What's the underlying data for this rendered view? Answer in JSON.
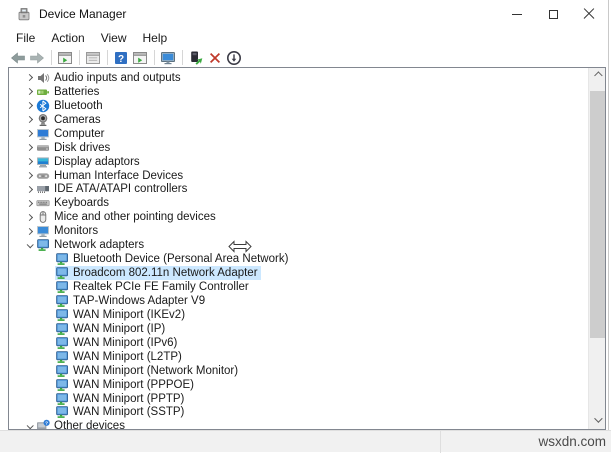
{
  "title_bar": {
    "title": "Device Manager",
    "controls": [
      {
        "name": "minimize-button"
      },
      {
        "name": "maximize-button"
      },
      {
        "name": "close-button"
      }
    ]
  },
  "menu_bar": {
    "items": [
      "File",
      "Action",
      "View",
      "Help"
    ]
  },
  "toolbar": {
    "items": [
      {
        "name": "back-button",
        "icon": "back-arrow-icon"
      },
      {
        "name": "forward-button",
        "icon": "forward-arrow-icon"
      },
      {
        "name": "separator"
      },
      {
        "name": "show-console-tree-button",
        "icon": "console-tree-icon"
      },
      {
        "name": "separator"
      },
      {
        "name": "export-list-button",
        "icon": "export-list-icon"
      },
      {
        "name": "separator"
      },
      {
        "name": "help-button",
        "icon": "help-icon"
      },
      {
        "name": "show-action-pane-button",
        "icon": "action-pane-icon"
      },
      {
        "name": "separator"
      },
      {
        "name": "properties-button",
        "icon": "computer-properties-icon"
      },
      {
        "name": "separator"
      },
      {
        "name": "update-driver-button",
        "icon": "update-driver-icon"
      },
      {
        "name": "uninstall-device-button",
        "icon": "uninstall-icon"
      },
      {
        "name": "scan-hardware-changes-button",
        "icon": "scan-changes-icon"
      }
    ]
  },
  "tree": {
    "items": [
      {
        "label": "Audio inputs and outputs",
        "icon": "audio-icon",
        "state": "collapsed",
        "level": 0
      },
      {
        "label": "Batteries",
        "icon": "battery-icon",
        "state": "collapsed",
        "level": 0
      },
      {
        "label": "Bluetooth",
        "icon": "bluetooth-icon",
        "state": "collapsed",
        "level": 0
      },
      {
        "label": "Cameras",
        "icon": "camera-icon",
        "state": "collapsed",
        "level": 0
      },
      {
        "label": "Computer",
        "icon": "computer-icon",
        "state": "collapsed",
        "level": 0
      },
      {
        "label": "Disk drives",
        "icon": "disk-drive-icon",
        "state": "collapsed",
        "level": 0
      },
      {
        "label": "Display adaptors",
        "icon": "display-adapter-icon",
        "state": "collapsed",
        "level": 0
      },
      {
        "label": "Human Interface Devices",
        "icon": "hid-icon",
        "state": "collapsed",
        "level": 0
      },
      {
        "label": "IDE ATA/ATAPI controllers",
        "icon": "ide-controller-icon",
        "state": "collapsed",
        "level": 0
      },
      {
        "label": "Keyboards",
        "icon": "keyboard-icon",
        "state": "collapsed",
        "level": 0
      },
      {
        "label": "Mice and other pointing devices",
        "icon": "mouse-icon",
        "state": "collapsed",
        "level": 0
      },
      {
        "label": "Monitors",
        "icon": "monitor-icon",
        "state": "collapsed",
        "level": 0
      },
      {
        "label": "Network adapters",
        "icon": "network-adapter-icon",
        "state": "expanded",
        "level": 0
      },
      {
        "label": "Bluetooth Device (Personal Area Network)",
        "icon": "network-adapter-icon",
        "level": 1
      },
      {
        "label": "Broadcom 802.11n Network Adapter",
        "icon": "network-adapter-icon",
        "level": 1,
        "selected": true
      },
      {
        "label": "Realtek PCIe FE Family Controller",
        "icon": "network-adapter-icon",
        "level": 1
      },
      {
        "label": "TAP-Windows Adapter V9",
        "icon": "network-adapter-icon",
        "level": 1
      },
      {
        "label": "WAN Miniport (IKEv2)",
        "icon": "network-adapter-icon",
        "level": 1
      },
      {
        "label": "WAN Miniport (IP)",
        "icon": "network-adapter-icon",
        "level": 1
      },
      {
        "label": "WAN Miniport (IPv6)",
        "icon": "network-adapter-icon",
        "level": 1
      },
      {
        "label": "WAN Miniport (L2TP)",
        "icon": "network-adapter-icon",
        "level": 1
      },
      {
        "label": "WAN Miniport (Network Monitor)",
        "icon": "network-adapter-icon",
        "level": 1
      },
      {
        "label": "WAN Miniport (PPPOE)",
        "icon": "network-adapter-icon",
        "level": 1
      },
      {
        "label": "WAN Miniport (PPTP)",
        "icon": "network-adapter-icon",
        "level": 1
      },
      {
        "label": "WAN Miniport (SSTP)",
        "icon": "network-adapter-icon",
        "level": 1
      },
      {
        "label": "Other devices",
        "icon": "unknown-device-icon",
        "state": "expanded",
        "level": 0
      }
    ]
  },
  "colors": {
    "selection_highlight": "#cce8ff",
    "panel_border": "#828790",
    "scrollbar_thumb": "#cdcdcd",
    "footer_bg": "#f1f1f1"
  },
  "footer": {
    "watermark": "wsxdn.com"
  }
}
